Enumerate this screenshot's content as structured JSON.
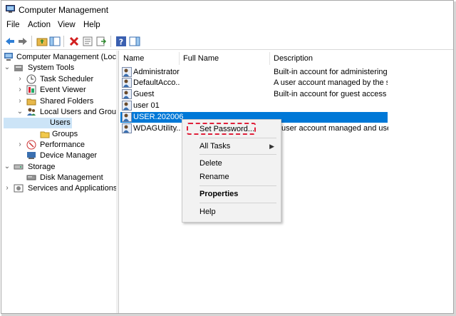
{
  "window": {
    "title": "Computer Management"
  },
  "menu": [
    "File",
    "Action",
    "View",
    "Help"
  ],
  "tree": {
    "root": "Computer Management (Local",
    "system_tools": "System Tools",
    "task_scheduler": "Task Scheduler",
    "event_viewer": "Event Viewer",
    "shared_folders": "Shared Folders",
    "local_users_groups": "Local Users and Groups",
    "users": "Users",
    "groups": "Groups",
    "performance": "Performance",
    "device_manager": "Device Manager",
    "storage": "Storage",
    "disk_management": "Disk Management",
    "services_apps": "Services and Applications"
  },
  "list": {
    "columns": [
      "Name",
      "Full Name",
      "Description"
    ],
    "rows": [
      {
        "name": "Administrator",
        "full_name": "",
        "description": "Built-in account for administering..."
      },
      {
        "name": "DefaultAcco...",
        "full_name": "",
        "description": "A user account managed by the s..."
      },
      {
        "name": "Guest",
        "full_name": "",
        "description": "Built-in account for guest access t..."
      },
      {
        "name": "user 01",
        "full_name": "",
        "description": ""
      },
      {
        "name": "USER.202006...",
        "full_name": "",
        "description": ""
      },
      {
        "name": "WDAGUtility...",
        "full_name": "",
        "description": "user account managed and use..."
      }
    ]
  },
  "context_menu": {
    "set_password": "Set Password...",
    "all_tasks": "All Tasks",
    "delete": "Delete",
    "rename": "Rename",
    "properties": "Properties",
    "help": "Help"
  },
  "colors": {
    "selection": "#0078d7",
    "highlight_box": "#e0203a"
  }
}
